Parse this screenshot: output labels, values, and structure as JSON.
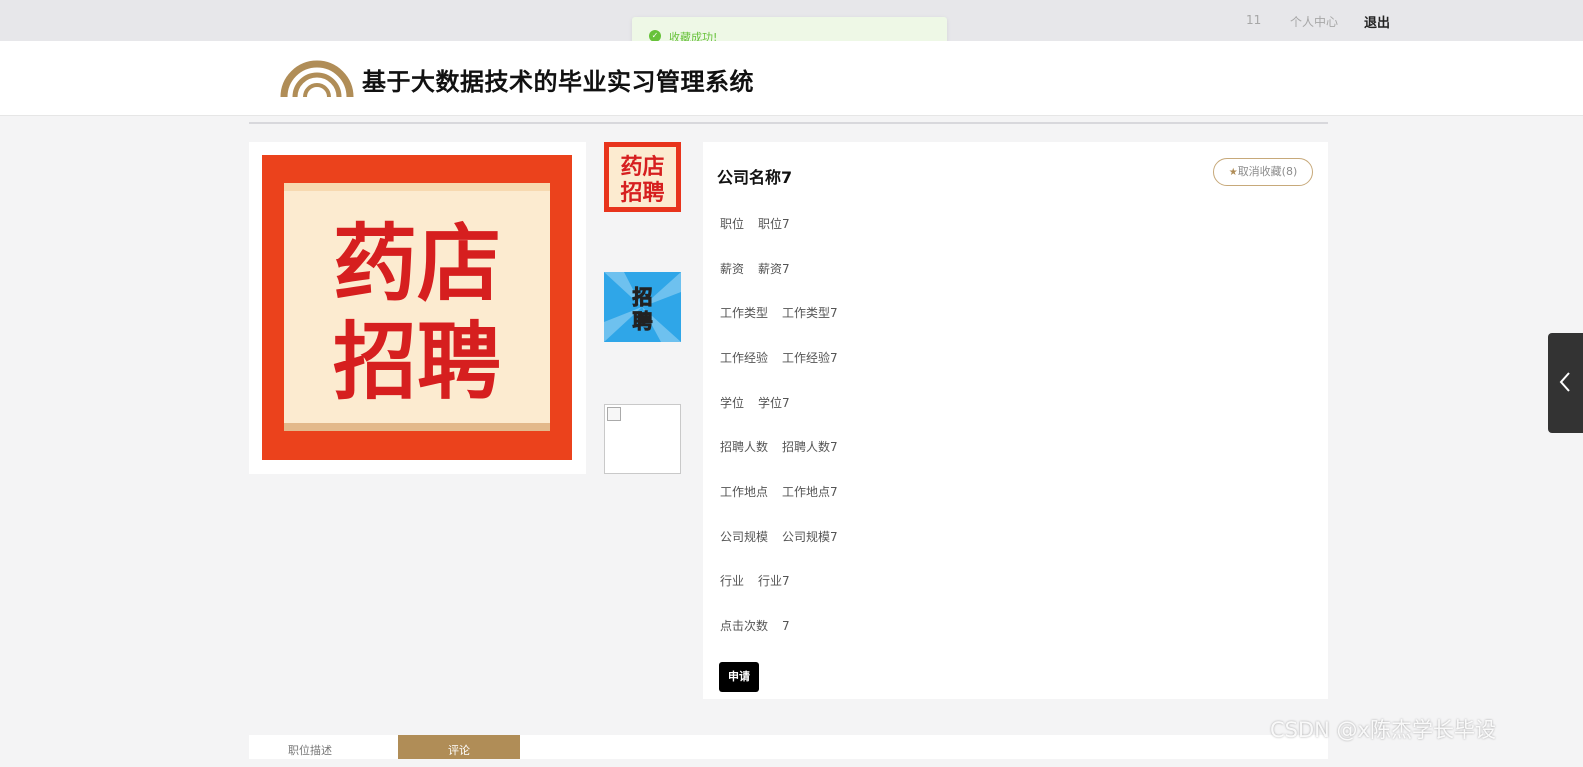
{
  "topbar": {
    "count": "11",
    "personal_center": "个人中心",
    "logout": "退出"
  },
  "toast": {
    "message": "收藏成功!",
    "icon": "check-circle-icon",
    "color": "#67c23a"
  },
  "header": {
    "title": "基于大数据技术的毕业实习管理系统",
    "logo_icon": "rainbow-arc-logo"
  },
  "gallery": {
    "main_image_text": [
      "药店",
      "招聘"
    ],
    "thumbnails": [
      {
        "text": [
          "药店",
          "招聘"
        ]
      },
      {
        "text": [
          "招",
          "聘"
        ]
      },
      {
        "text": []
      }
    ]
  },
  "detail": {
    "company_name": "公司名称7",
    "favorite_button": "取消收藏(8)",
    "fields": [
      {
        "label": "职位",
        "value": "职位7"
      },
      {
        "label": "薪资",
        "value": "薪资7"
      },
      {
        "label": "工作类型",
        "value": "工作类型7"
      },
      {
        "label": "工作经验",
        "value": "工作经验7"
      },
      {
        "label": "学位",
        "value": "学位7"
      },
      {
        "label": "招聘人数",
        "value": "招聘人数7"
      },
      {
        "label": "工作地点",
        "value": "工作地点7"
      },
      {
        "label": "公司规模",
        "value": "公司规模7"
      },
      {
        "label": "行业",
        "value": "行业7"
      },
      {
        "label": "点击次数",
        "value": "7"
      }
    ],
    "apply_button": "申请"
  },
  "tabs": [
    {
      "label": "职位描述",
      "active": false
    },
    {
      "label": "评论",
      "active": true
    }
  ],
  "watermark": "CSDN @x陈杰学长毕设",
  "colors": {
    "accent": "#b08d57",
    "success": "#67c23a",
    "poster_red": "#e8341c"
  }
}
